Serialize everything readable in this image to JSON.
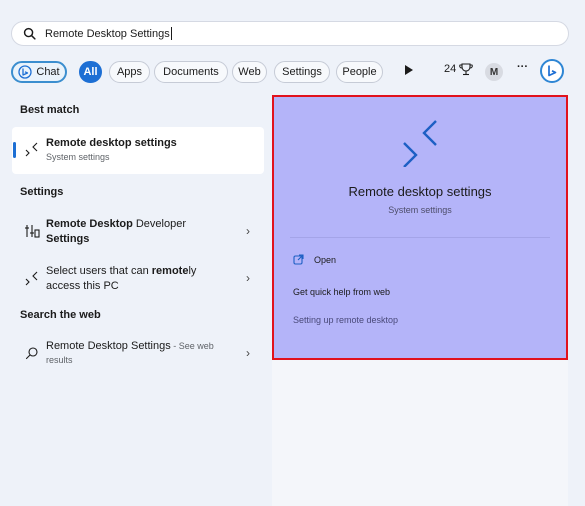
{
  "search": {
    "value": "Remote Desktop Settings"
  },
  "filters": {
    "chat": "Chat",
    "all": "All",
    "apps": "Apps",
    "documents": "Documents",
    "web": "Web",
    "settings": "Settings",
    "people": "People",
    "points": "24",
    "avatar": "M",
    "more": "···"
  },
  "sections": {
    "best_match": "Best match",
    "settings": "Settings",
    "search_web": "Search the web"
  },
  "best_match": {
    "title": "Remote desktop settings",
    "subtitle": "System settings"
  },
  "settings_results": [
    {
      "title_bold": "Remote Desktop",
      "title_rest_line1": " Developer",
      "title_line2_bold": "Settings"
    },
    {
      "title_pre": "Select users that can ",
      "title_bold": "remote",
      "title_post": "ly",
      "title_line2": "access this PC"
    }
  ],
  "web_result": {
    "title": "Remote Desktop Settings",
    "suffix": " - See web",
    "line2": "results"
  },
  "preview": {
    "title": "Remote desktop settings",
    "subtitle": "System settings",
    "open": "Open",
    "help": "Get quick help from web",
    "link": "Setting up remote desktop"
  },
  "colors": {
    "accent": "#1d6fd4",
    "preview_bg": "#b4b4f9",
    "highlight_border": "#e1121d"
  }
}
